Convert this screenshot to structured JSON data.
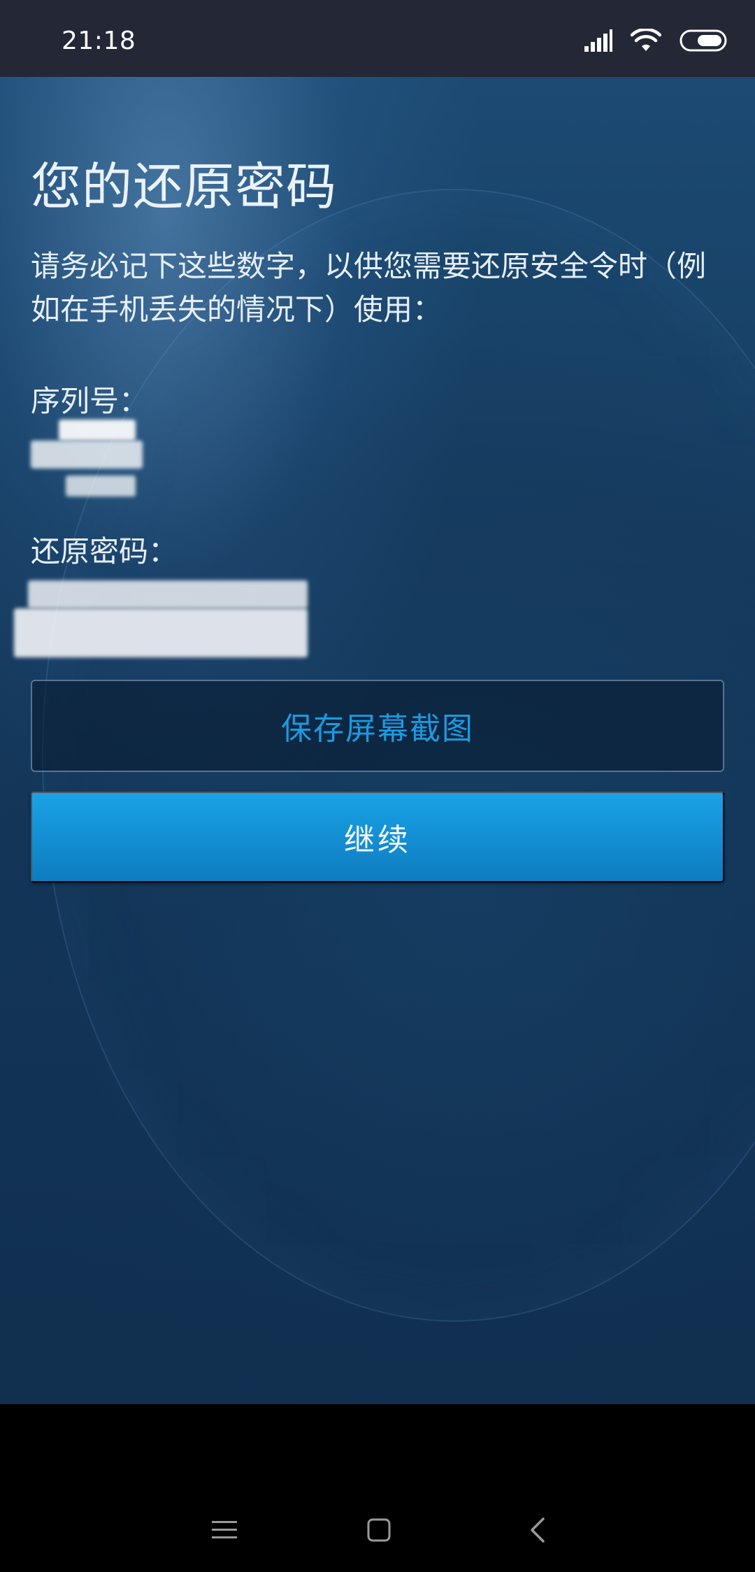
{
  "status_bar": {
    "time": "21:18",
    "icons": [
      "signal-icon",
      "wifi-icon",
      "battery-icon"
    ]
  },
  "screen": {
    "title": "您的还原密码",
    "instructions": "请务必记下这些数字，以供您需要还原安全令时（例如在手机丢失的情况下）使用：",
    "serial_label": "序列号：",
    "restore_label": "还原密码："
  },
  "buttons": {
    "save_screenshot": "保存屏幕截图",
    "continue": "继续"
  },
  "nav_bar": {
    "icons": [
      "menu-icon",
      "home-icon",
      "back-icon"
    ]
  },
  "colors": {
    "accent": "#1b9ae0",
    "primary_button": "#1494d6",
    "status_bar_bg": "#232736"
  }
}
